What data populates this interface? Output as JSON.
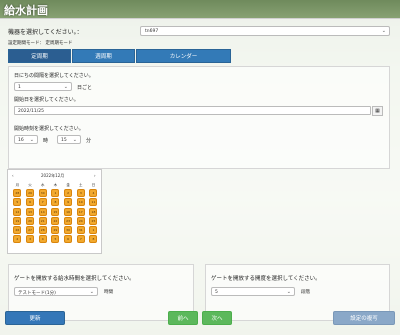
{
  "title": "給水計画",
  "device": {
    "label": "機器を選択してください。：",
    "selected": "tn697",
    "mode_label": "設定期間モード：",
    "mode_value": "定周期モード"
  },
  "tabs": [
    "定周期",
    "週周期",
    "カレンダー"
  ],
  "period": {
    "interval_label": "日にちの間隔を選択してください。",
    "interval_value": "1",
    "interval_unit": "日ごと",
    "start_date_label": "開始日を選択してください。",
    "start_date_value": "2022/11/25",
    "start_time_label": "開始時刻を選択してください。",
    "hour_value": "16",
    "hour_unit": "時",
    "minute_value": "15",
    "minute_unit": "分"
  },
  "calendar": {
    "prev": "‹",
    "next": "›",
    "month_label": "2022年12月",
    "weekdays": [
      "月",
      "火",
      "水",
      "木",
      "金",
      "土",
      "日"
    ],
    "rows": [
      [
        "28",
        "29",
        "30",
        "1",
        "2",
        "3",
        "4"
      ],
      [
        "5",
        "6",
        "7",
        "8",
        "9",
        "10",
        "11"
      ],
      [
        "12",
        "13",
        "14",
        "15",
        "16",
        "17",
        "18"
      ],
      [
        "19",
        "20",
        "21",
        "22",
        "23",
        "24",
        "25"
      ],
      [
        "26",
        "27",
        "28",
        "29",
        "30",
        "31",
        "1"
      ],
      [
        "2",
        "3",
        "4",
        "5",
        "6",
        "7",
        "8"
      ]
    ]
  },
  "feed_time": {
    "label": "ゲートを開放する給水時間を選択してください。",
    "value": "テストモード(1分)",
    "unit": "時間"
  },
  "gate_degree": {
    "label": "ゲートを開放する開度を選択してください。",
    "value": "5",
    "unit": "段階"
  },
  "buttons": {
    "update": "更新",
    "prev": "前へ",
    "next": "次へ",
    "copy": "設定の複写"
  }
}
